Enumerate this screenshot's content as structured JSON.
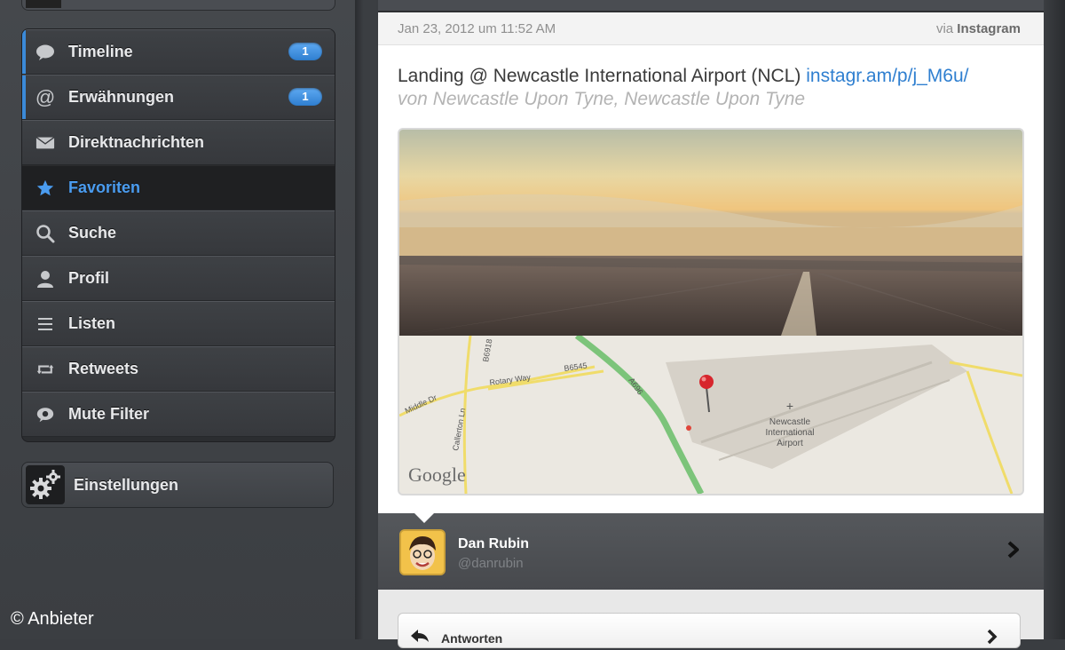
{
  "sidebar": {
    "items": [
      {
        "label": "Timeline",
        "icon": "speech-bubble-icon",
        "badge": "1"
      },
      {
        "label": "Erwähnungen",
        "icon": "at-icon",
        "badge": "1"
      },
      {
        "label": "Direktnachrichten",
        "icon": "envelope-icon"
      },
      {
        "label": "Favoriten",
        "icon": "star-icon"
      },
      {
        "label": "Suche",
        "icon": "search-icon"
      },
      {
        "label": "Profil",
        "icon": "person-icon"
      },
      {
        "label": "Listen",
        "icon": "list-icon"
      },
      {
        "label": "Retweets",
        "icon": "retweet-icon"
      },
      {
        "label": "Mute Filter",
        "icon": "mute-icon"
      }
    ],
    "active_item": "Favoriten",
    "settings_label": "Einstellungen"
  },
  "tweet": {
    "timestamp": "Jan 23, 2012 um 11:52 AM",
    "via_prefix": "via",
    "via_source": "Instagram",
    "text": "Landing  @ Newcastle International Airport (NCL)",
    "link": "instagr.am/p/j_M6u/",
    "location": "von Newcastle Upon Tyne, Newcastle Upon Tyne"
  },
  "map": {
    "roads": [
      "Middle Dr",
      "Rotary Way",
      "Callerton Ln",
      "B6545",
      "B6918",
      "A696"
    ],
    "airport_label_1": "Newcastle",
    "airport_label_2": "International",
    "airport_label_3": "Airport",
    "attribution": "Google"
  },
  "author": {
    "name": "Dan Rubin",
    "handle": "@danrubin"
  },
  "actions": {
    "reply_label": "Antworten"
  },
  "copyright": "© Anbieter",
  "colors": {
    "accent": "#3b8ad8",
    "link": "#2f7fd0",
    "badge": "#3b8ad8"
  }
}
